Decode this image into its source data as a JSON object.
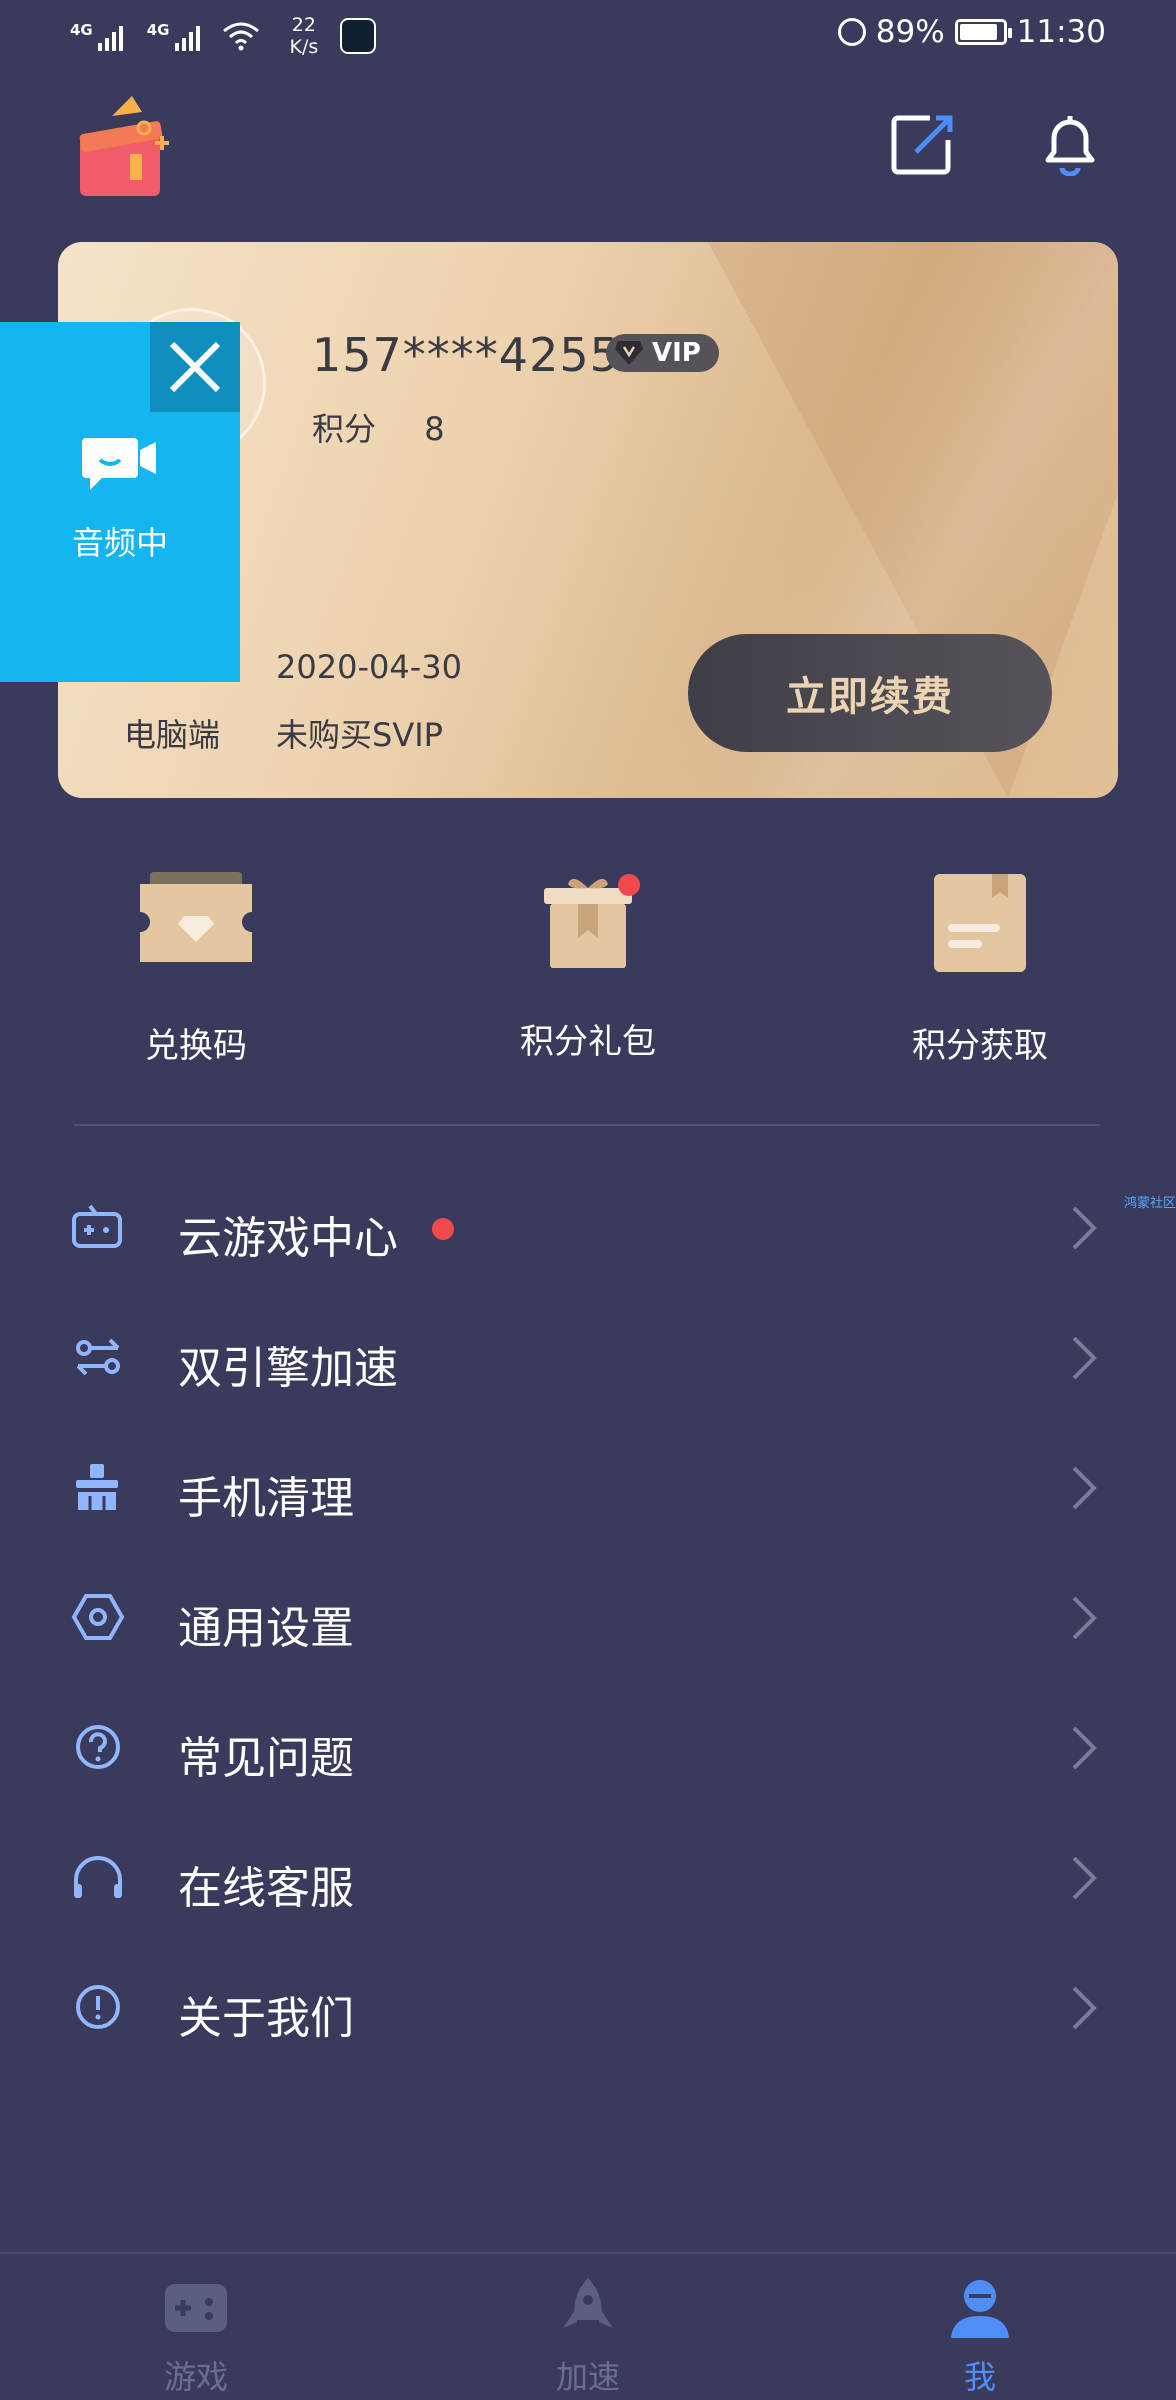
{
  "status_bar": {
    "network_1": "4G",
    "network_2": "4G",
    "speed_value": "22",
    "speed_unit": "K/s",
    "battery": "89%",
    "time": "11:30"
  },
  "card": {
    "phone": "157****4255",
    "vip_badge": "VIP",
    "points_label": "积分",
    "points_value": "8",
    "expiry_date": "2020-04-30",
    "pc_label": "电脑端",
    "pc_status": "未购买SVIP",
    "renew_label": "立即续费"
  },
  "floater": {
    "label": "音频中"
  },
  "quick_actions": [
    {
      "label": "兑换码",
      "icon": "ticket-icon"
    },
    {
      "label": "积分礼包",
      "icon": "gift-box-icon",
      "badge": true
    },
    {
      "label": "积分获取",
      "icon": "note-book-icon"
    }
  ],
  "menu": [
    {
      "label": "云游戏中心",
      "icon": "gamepad-icon",
      "badge": true
    },
    {
      "label": "双引擎加速",
      "icon": "dual-engine-icon"
    },
    {
      "label": "手机清理",
      "icon": "broom-icon"
    },
    {
      "label": "通用设置",
      "icon": "hexagon-settings-icon"
    },
    {
      "label": "常见问题",
      "icon": "question-icon"
    },
    {
      "label": "在线客服",
      "icon": "headset-icon"
    },
    {
      "label": "关于我们",
      "icon": "info-icon"
    }
  ],
  "side_tag": "鸿蒙社区",
  "bottom_nav": [
    {
      "label": "游戏",
      "icon": "game-controller-icon",
      "active": false
    },
    {
      "label": "加速",
      "icon": "rocket-icon",
      "active": false
    },
    {
      "label": "我",
      "icon": "profile-icon",
      "active": true
    }
  ],
  "colors": {
    "background": "#393a5c",
    "accent": "#4f8ef7",
    "badge_red": "#f04a4f",
    "floater_blue": "#14b5f0"
  }
}
